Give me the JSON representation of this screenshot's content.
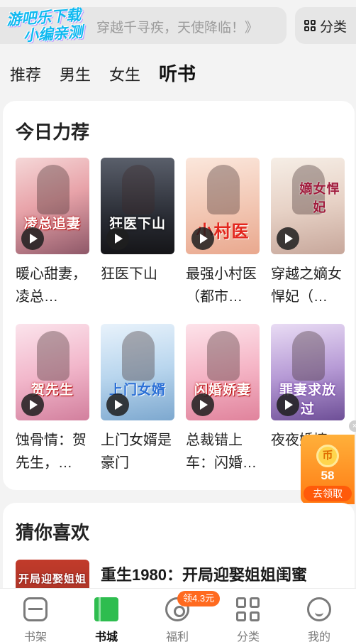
{
  "header": {
    "watermark_line1": "游吧乐下载",
    "watermark_line2": "小编亲测",
    "search_placeholder": "穿越千寻疾，天使降临！》",
    "category_button": "分类"
  },
  "tabs": [
    {
      "label": "推荐",
      "active": false
    },
    {
      "label": "男生",
      "active": false
    },
    {
      "label": "女生",
      "active": false
    },
    {
      "label": "听书",
      "active": true
    }
  ],
  "today": {
    "title": "今日力荐",
    "books": [
      {
        "title": "暖心甜妻，凌总…",
        "cover_text": "凌总追妻"
      },
      {
        "title": "狂医下山",
        "cover_text": "狂医下山"
      },
      {
        "title": "最强小村医（都市…",
        "cover_text": "小村医"
      },
      {
        "title": "穿越之嫡女悍妃（…",
        "cover_text": "嫡女悍妃"
      },
      {
        "title": "蚀骨情：贺先生，…",
        "cover_text": "贺先生"
      },
      {
        "title": "上门女婿是豪门",
        "cover_text": "上门女婿"
      },
      {
        "title": "总裁错上车：闪婚…",
        "cover_text": "闪婚娇妻"
      },
      {
        "title": "夜夜婚情：",
        "cover_text": "罪妻求放过"
      }
    ]
  },
  "reward": {
    "coin_glyph": "币",
    "amount": "58",
    "label": "去领取",
    "close_glyph": "×"
  },
  "guess": {
    "title": "猜你喜欢",
    "book": {
      "title": "重生1980：开局迎娶姐姐闺蜜",
      "cover_text": "开局迎娶姐姐闺蜜"
    }
  },
  "bottom_nav": [
    {
      "label": "书架",
      "icon": "bookshelf-icon",
      "active": false
    },
    {
      "label": "书城",
      "icon": "bookstore-icon",
      "active": true
    },
    {
      "label": "福利",
      "icon": "welfare-icon",
      "active": false
    },
    {
      "label": "分类",
      "icon": "category-icon",
      "active": false
    },
    {
      "label": "我的",
      "icon": "profile-icon",
      "active": false
    }
  ],
  "welfare_badge": "领4.3元",
  "colors": {
    "accent_green": "#2ebd4f",
    "reward_orange": "#ff7b14"
  }
}
